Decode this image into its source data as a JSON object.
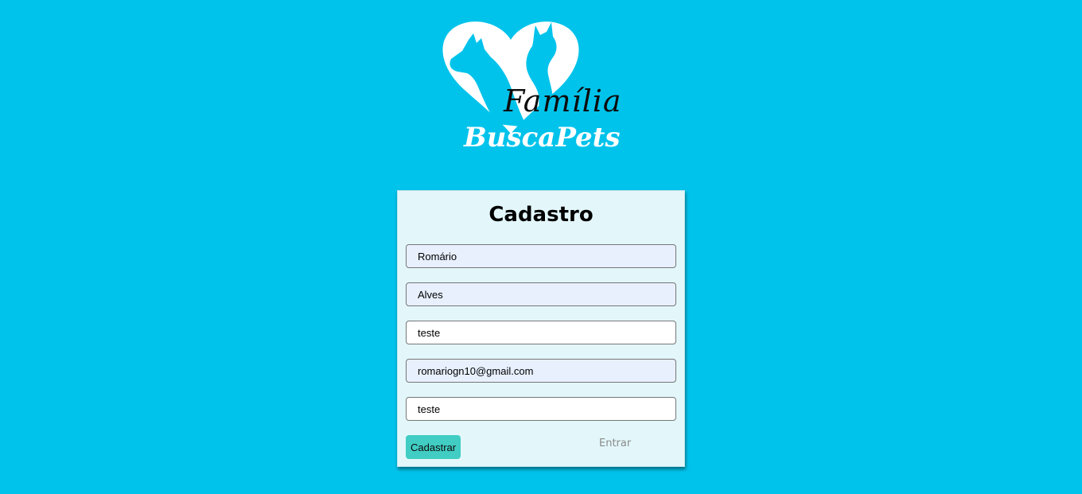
{
  "logo": {
    "line1": "Família",
    "line2": "BuscaPets"
  },
  "form": {
    "title": "Cadastro",
    "fields": [
      {
        "value": "Romário",
        "autofilled": true
      },
      {
        "value": "Alves",
        "autofilled": true
      },
      {
        "value": "teste",
        "autofilled": false
      },
      {
        "value": "romariogn10@gmail.com",
        "autofilled": true
      },
      {
        "value": "teste",
        "autofilled": false
      }
    ],
    "submit_label": "Cadastrar",
    "login_link": "Entrar"
  },
  "colors": {
    "background": "#00c3eb",
    "card": "#e3f7fb",
    "button": "#41cdc3",
    "autofill": "#e8f0fe"
  }
}
